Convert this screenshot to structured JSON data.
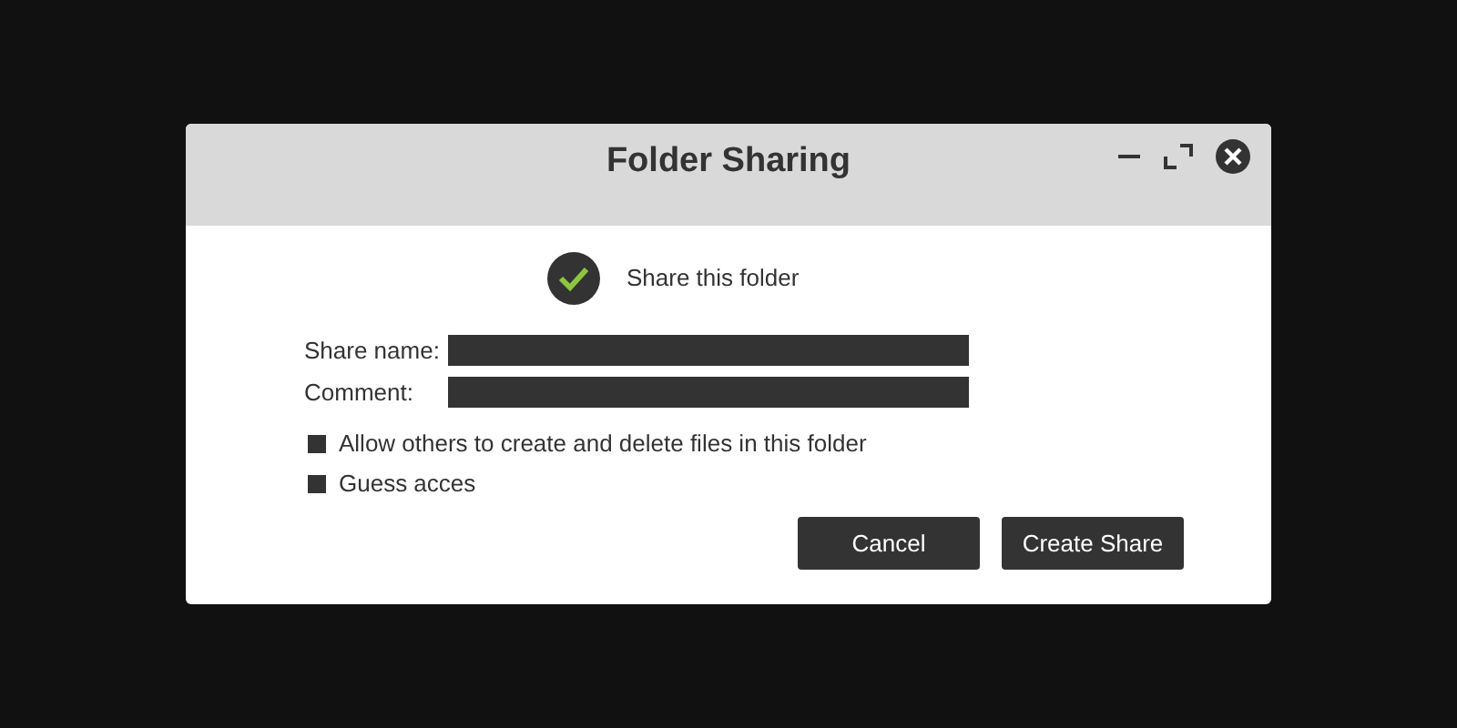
{
  "window": {
    "title": "Folder Sharing"
  },
  "share_toggle": {
    "label": "Share this folder",
    "checked": true
  },
  "fields": [
    {
      "label": "Share name:"
    },
    {
      "label": "Comment:"
    }
  ],
  "options": [
    {
      "label": "Allow others to create and delete files in this folder",
      "checked": false
    },
    {
      "label": "Guess acces",
      "checked": false
    }
  ],
  "buttons": [
    "Cancel",
    "Create Share"
  ]
}
